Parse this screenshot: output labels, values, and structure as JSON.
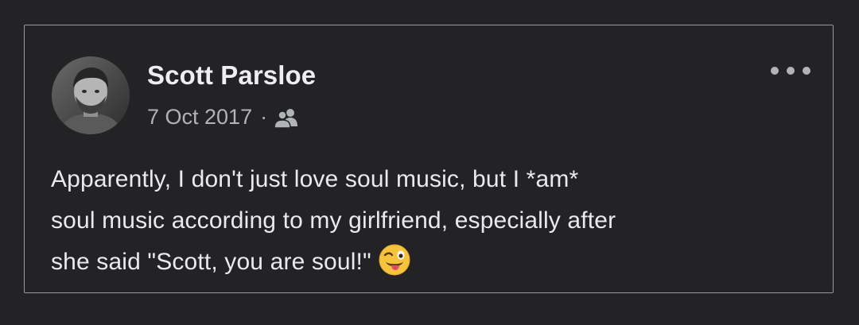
{
  "post": {
    "author_name": "Scott Parsloe",
    "date": "7 Oct 2017",
    "separator": "·",
    "audience_icon": "friends-icon",
    "more_icon": "more-options-icon",
    "body_lines": [
      "Apparently, I don't just love soul music, but I *am*",
      "soul music according to my girlfriend, especially after",
      "she said \"Scott, you are soul!\""
    ],
    "emoji": "winking-face-with-tongue-icon"
  },
  "colors": {
    "background": "#232325",
    "card_border": "#9a9a9c",
    "name_text": "#eceef0",
    "meta_text": "#b0b3b8",
    "body_text": "#e8eaed",
    "emoji_face": "#f5c43c"
  }
}
